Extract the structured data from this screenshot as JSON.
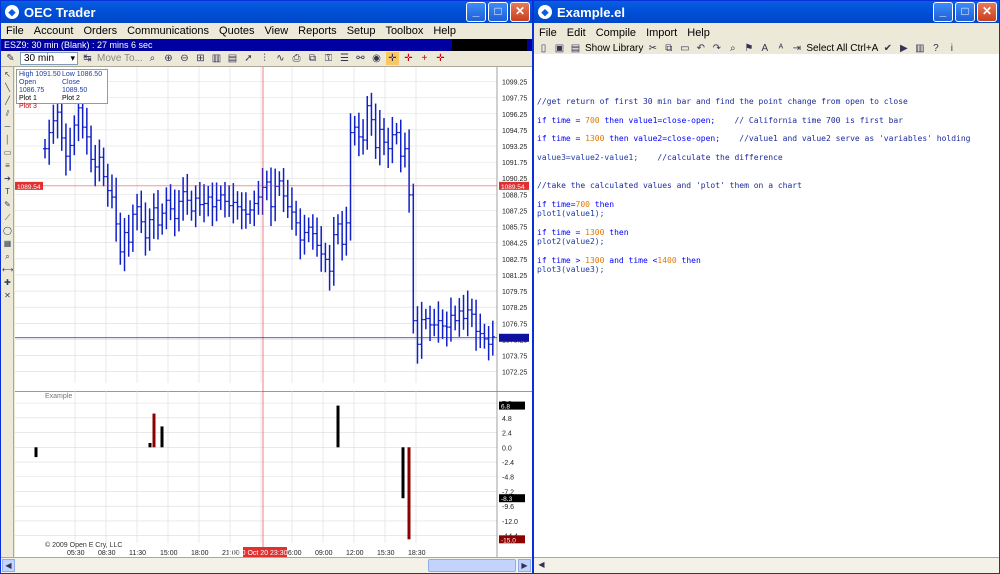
{
  "oec": {
    "title": "OEC Trader",
    "menu": [
      "File",
      "Account",
      "Orders",
      "Communications",
      "Quotes",
      "View",
      "Reports",
      "Setup",
      "Toolbox",
      "Help"
    ],
    "status": "ESZ9: 30 min (Blank) : 27 mins 6 sec",
    "interval": "30 min",
    "move_to": "Move To...",
    "info": {
      "high": "High 1091.50",
      "low": "Low 1086.50",
      "open": "Open 1086.75",
      "close": "Close 1089.50",
      "plot1": "Plot 1",
      "plot2": "Plot 2",
      "plot3": "Plot 3"
    },
    "copyright": "© 2009 Open E Cry, LLC",
    "indicator_label": "Example",
    "crosshair_time": "21:00 Oct 20 23:30",
    "current_price": "1089.54",
    "indicator_values": [
      "6.8",
      "-8.3",
      "-15.0"
    ]
  },
  "editor": {
    "title": "Example.el",
    "menu": [
      "File",
      "Edit",
      "Compile",
      "Import",
      "Help"
    ],
    "show_library": "Show Library",
    "select_all": "Select All Ctrl+A",
    "code": [
      [
        {
          "t": "//get return of first 30 min bar and find the point change from open to close",
          "c": "comment"
        }
      ],
      [
        {
          "t": "if time = ",
          "c": "kw"
        },
        {
          "t": "700",
          "c": "num"
        },
        {
          "t": " then value1=close-open;    ",
          "c": "kw"
        },
        {
          "t": "// California time 700 is first bar",
          "c": "comment"
        }
      ],
      [
        {
          "t": "if time = ",
          "c": "kw"
        },
        {
          "t": "1300",
          "c": "num"
        },
        {
          "t": " then value2=close-open;    ",
          "c": "kw"
        },
        {
          "t": "//value1 and value2 serve as 'variables' holding",
          "c": "comment"
        }
      ],
      [
        {
          "t": "value3=value2-value1;    ",
          "c": "plain"
        },
        {
          "t": "//calculate the difference",
          "c": "comment"
        }
      ],
      [
        {
          "t": "//take the calculated values and 'plot' them on a chart",
          "c": "comment"
        }
      ],
      [
        {
          "t": "if time=",
          "c": "kw"
        },
        {
          "t": "700",
          "c": "num"
        },
        {
          "t": " then",
          "c": "kw"
        }
      ],
      [
        {
          "t": "plot1(value1);",
          "c": "plain"
        }
      ],
      [
        {
          "t": "if time = ",
          "c": "kw"
        },
        {
          "t": "1300",
          "c": "num"
        },
        {
          "t": " then",
          "c": "kw"
        }
      ],
      [
        {
          "t": "plot2(value2);",
          "c": "plain"
        }
      ],
      [
        {
          "t": "if time > ",
          "c": "kw"
        },
        {
          "t": "1300",
          "c": "num"
        },
        {
          "t": " and time <",
          "c": "kw"
        },
        {
          "t": "1400",
          "c": "num"
        },
        {
          "t": " then",
          "c": "kw"
        }
      ],
      [
        {
          "t": "plot3(value3);",
          "c": "plain"
        }
      ]
    ]
  },
  "chart_data": [
    {
      "type": "ohlc",
      "title": "",
      "x_ticks": [
        "05:30",
        "08:30",
        "11:30",
        "15:00",
        "18:00",
        "21:00",
        "03:00",
        "06:00",
        "09:00",
        "12:00",
        "15:30",
        "18:30"
      ],
      "y_ticks": [
        1099.25,
        1097.75,
        1096.25,
        1094.75,
        1093.25,
        1091.75,
        1090.25,
        1088.75,
        1087.25,
        1085.75,
        1084.25,
        1082.75,
        1081.25,
        1079.75,
        1078.25,
        1076.75,
        1075.25,
        1073.75,
        1072.25
      ],
      "ylim": [
        1071.2,
        1100.6
      ],
      "grid": true,
      "series": [
        {
          "close": [
            1093.0,
            1094.5,
            1095.6,
            1096.4,
            1094.0,
            1092.3,
            1093.3,
            1095.2,
            1096.8,
            1095.0,
            1094.1,
            1092.0,
            1091.3,
            1092.2,
            1090.4,
            1089.1,
            1088.5,
            1086.0,
            1083.4,
            1085.2,
            1084.3,
            1086.9,
            1087.6,
            1086.2,
            1084.7,
            1086.4,
            1087.5,
            1085.9,
            1087.0,
            1088.2,
            1087.4,
            1086.5,
            1088.1,
            1089.0,
            1088.2,
            1087.2,
            1088.4,
            1087.8,
            1087.9,
            1088.5,
            1087.6,
            1088.2,
            1088.7,
            1088.1,
            1087.7,
            1088.0,
            1087.6,
            1087.3,
            1086.9,
            1087.3,
            1087.9,
            1088.5,
            1089.4,
            1089.9,
            1087.6,
            1089.5,
            1090.0,
            1088.6,
            1087.6,
            1087.1,
            1086.1,
            1084.5,
            1085.2,
            1085.7,
            1085.1,
            1084.0,
            1083.2,
            1082.7,
            1081.6,
            1085.0,
            1086.0,
            1084.1,
            1086.1,
            1094.5,
            1095.0,
            1094.1,
            1093.8,
            1097.0,
            1095.7,
            1093.1,
            1094.8,
            1093.6,
            1093.0,
            1094.3,
            1094.5,
            1092.3,
            1093.0,
            1088.7,
            1077.0,
            1074.8,
            1077.1,
            1077.2,
            1076.6,
            1076.6,
            1077.0,
            1076.5,
            1076.4,
            1077.5,
            1077.0,
            1077.9,
            1077.2,
            1078.0,
            1077.6,
            1076.0,
            1075.8,
            1075.3,
            1074.8,
            1075.5
          ]
        }
      ]
    },
    {
      "type": "bar",
      "title": "",
      "y_ticks": [
        7.2,
        4.8,
        2.4,
        0.0,
        -2.4,
        -4.8,
        -7.2,
        -9.6,
        -12.0,
        -14.4
      ],
      "ylim": [
        -15.6,
        8.2
      ],
      "series": [
        {
          "name": "Plot 1",
          "points": [
            {
              "x": 21,
              "value": -1.6
            },
            {
              "x": 147,
              "value": 3.4
            }
          ]
        },
        {
          "name": "Plot 2",
          "points": [
            {
              "x": 135,
              "value": 0.7
            },
            {
              "x": 323,
              "value": 6.8
            },
            {
              "x": 388,
              "value": -8.3
            }
          ]
        },
        {
          "name": "Plot 3",
          "points": [
            {
              "x": 139,
              "value": 5.5
            },
            {
              "x": 394,
              "value": -15.0
            }
          ]
        }
      ]
    }
  ]
}
